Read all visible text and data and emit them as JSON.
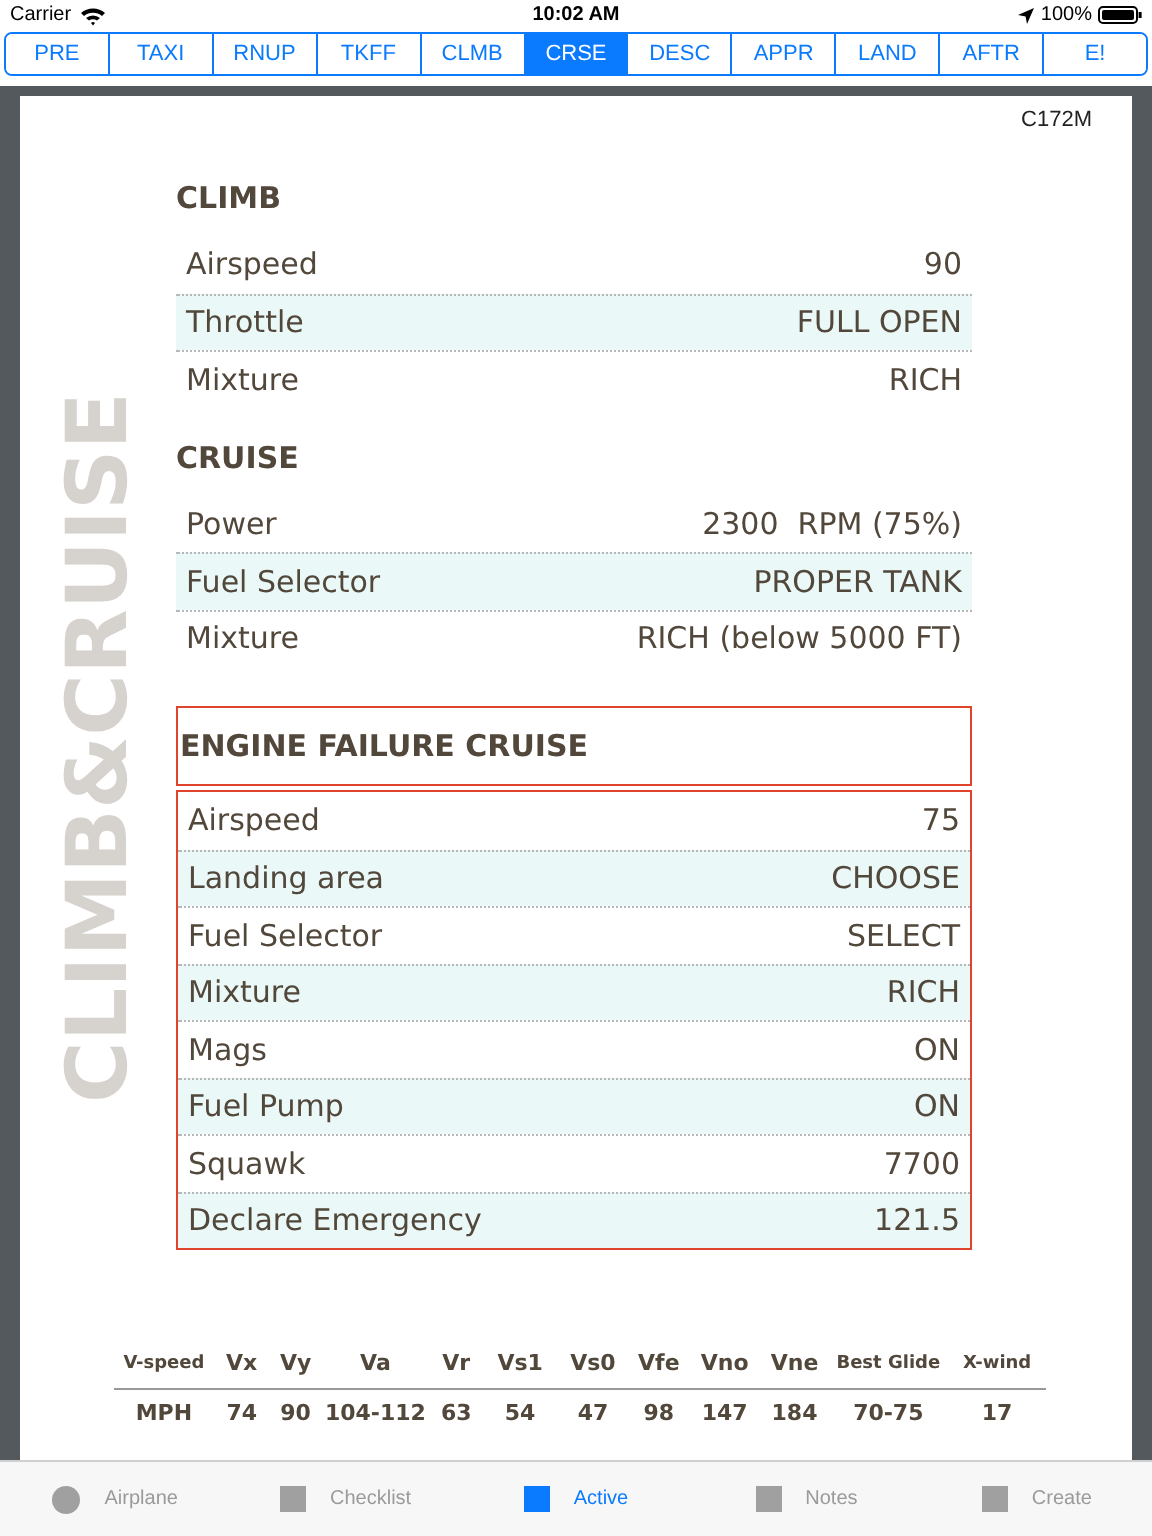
{
  "status_bar": {
    "carrier": "Carrier",
    "time": "10:02 AM",
    "battery": "100%"
  },
  "tabs": [
    {
      "label": "PRE",
      "selected": false
    },
    {
      "label": "TAXI",
      "selected": false
    },
    {
      "label": "RNUP",
      "selected": false
    },
    {
      "label": "TKFF",
      "selected": false
    },
    {
      "label": "CLMB",
      "selected": false
    },
    {
      "label": "CRSE",
      "selected": true
    },
    {
      "label": "DESC",
      "selected": false
    },
    {
      "label": "APPR",
      "selected": false
    },
    {
      "label": "LAND",
      "selected": false
    },
    {
      "label": "AFTR",
      "selected": false
    },
    {
      "label": "E!",
      "selected": false
    }
  ],
  "document": {
    "aircraft": "C172M",
    "side_title": "CLIMB&CRUISE",
    "sections": [
      {
        "title": "CLIMB",
        "emphasized": false,
        "rows": [
          {
            "label": "Airspeed",
            "value": "90"
          },
          {
            "label": "Throttle",
            "value": "FULL OPEN"
          },
          {
            "label": "Mixture",
            "value": "RICH"
          }
        ]
      },
      {
        "title": "CRUISE",
        "emphasized": false,
        "rows": [
          {
            "label": "Power",
            "value": "2300  RPM (75%)"
          },
          {
            "label": "Fuel Selector",
            "value": "PROPER TANK"
          },
          {
            "label": "Mixture",
            "value": "RICH (below 5000 FT)"
          }
        ]
      },
      {
        "title": "ENGINE FAILURE CRUISE",
        "emphasized": true,
        "rows": [
          {
            "label": "Airspeed",
            "value": "75"
          },
          {
            "label": "Landing area",
            "value": "CHOOSE"
          },
          {
            "label": "Fuel Selector",
            "value": "SELECT"
          },
          {
            "label": "Mixture",
            "value": "RICH"
          },
          {
            "label": "Mags",
            "value": "ON"
          },
          {
            "label": "Fuel Pump",
            "value": "ON"
          },
          {
            "label": "Squawk",
            "value": "7700"
          },
          {
            "label": "Declare Emergency",
            "value": "121.5"
          }
        ]
      }
    ]
  },
  "vspeeds": {
    "columns": [
      "V-speed",
      "Vx",
      "Vy",
      "Va",
      "Vr",
      "Vs1",
      "Vs0",
      "Vfe",
      "Vno",
      "Vne",
      "Best Glide",
      "X-wind"
    ],
    "rows": [
      [
        "MPH",
        "74",
        "90",
        "104-112",
        "63",
        "54",
        "47",
        "98",
        "147",
        "184",
        "70-75",
        "17"
      ]
    ]
  },
  "bottom_tabs": [
    {
      "label": "Airplane",
      "kind": "circle",
      "selected": false
    },
    {
      "label": "Checklist",
      "kind": "square",
      "selected": false
    },
    {
      "label": "Active",
      "kind": "square",
      "selected": true
    },
    {
      "label": "Notes",
      "kind": "square",
      "selected": false
    },
    {
      "label": "Create",
      "kind": "square",
      "selected": false
    }
  ]
}
